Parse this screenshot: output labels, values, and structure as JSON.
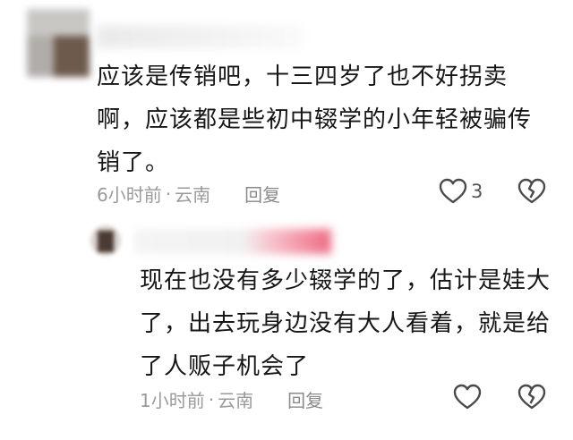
{
  "comments": [
    {
      "text": "应该是传销吧，十三四岁了也不好拐卖\n啊，应该都是些初中辍学的小年轻被骗传\n销了。",
      "time": "6小时前",
      "separator": "·",
      "location": "云南",
      "reply_label": "回复",
      "like_count": "3"
    },
    {
      "text": "现在也没有多少辍学的了，估计是娃大\n了，出去玩身边没有大人看着，就是给\n了人贩子机会了",
      "time": "1小时前",
      "separator": "·",
      "location": "云南",
      "reply_label": "回复",
      "like_count": ""
    }
  ],
  "icons": {
    "like": "heart-outline-icon",
    "dislike": "broken-heart-icon"
  },
  "colors": {
    "text": "#161616",
    "meta": "#9a9a9a",
    "icon": "#4a4a4a",
    "reply_name_accent": "#f06a85"
  }
}
